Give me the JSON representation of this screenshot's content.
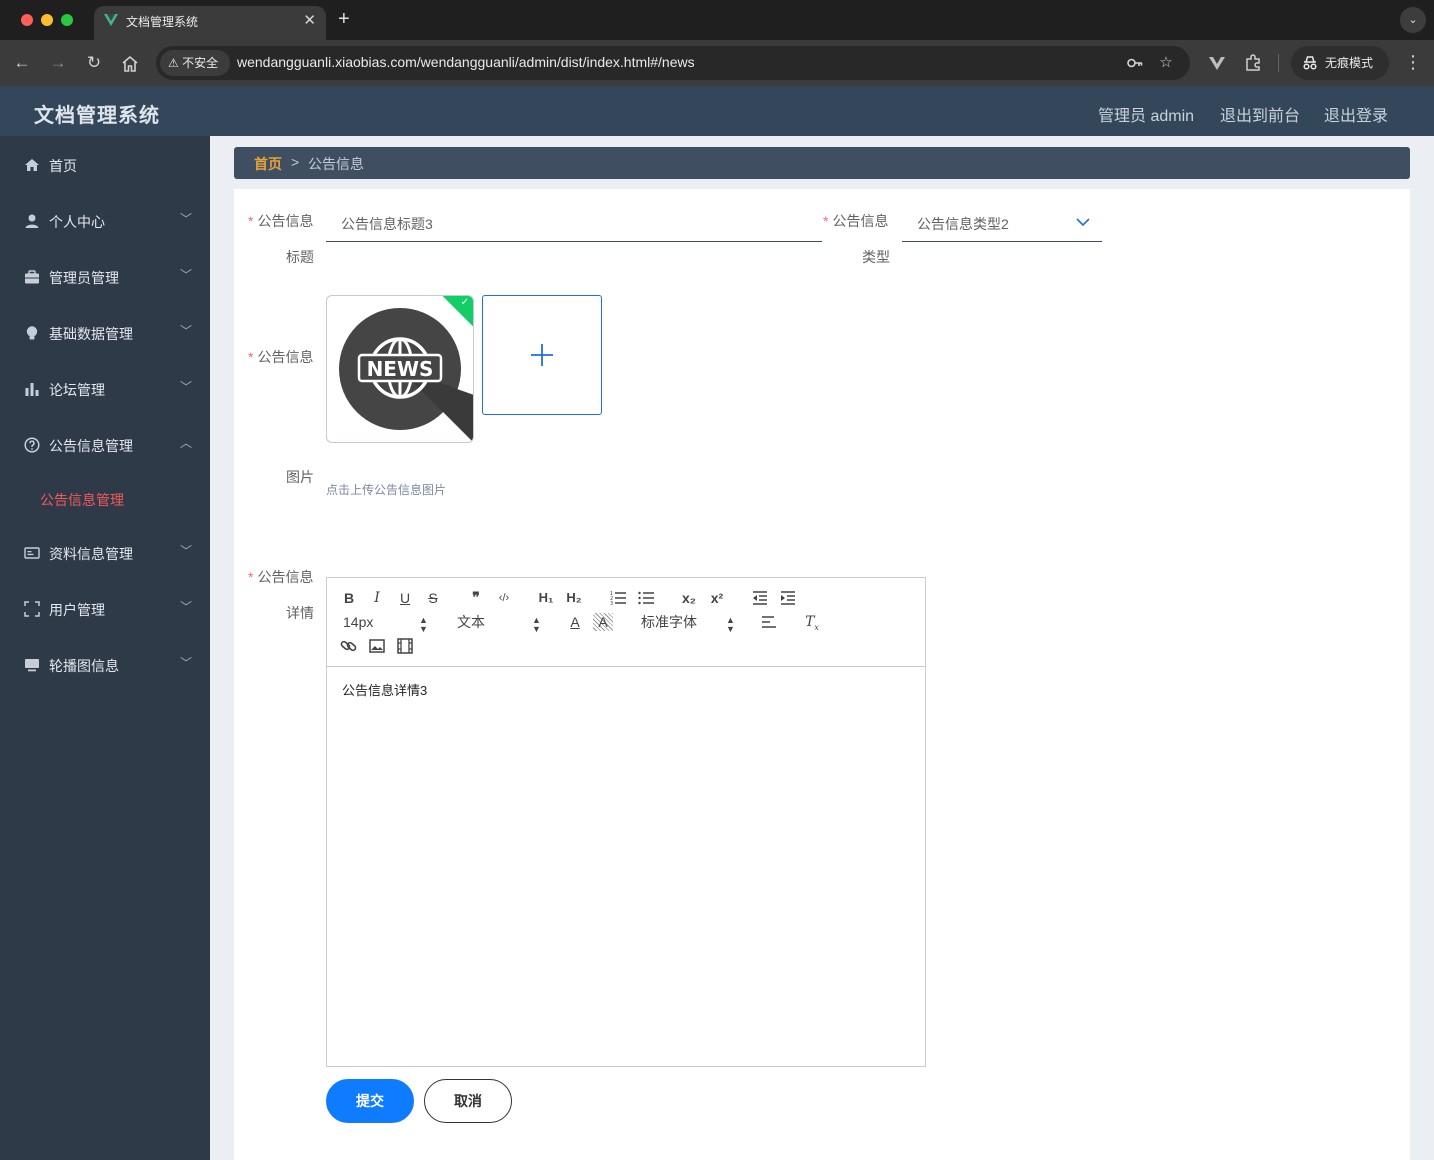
{
  "browser": {
    "tab_title": "文档管理系统",
    "tab_close": "✕",
    "new_tab": "+",
    "tab_menu": "⌄",
    "security_label": "不安全",
    "url": "wendangguanli.xiaobias.com/wendangguanli/admin/dist/index.html#/news",
    "incognito_label": "无痕模式"
  },
  "header": {
    "title": "文档管理系统",
    "user": "管理员 admin",
    "to_frontend": "退出到前台",
    "logout": "退出登录"
  },
  "sidebar": {
    "items": [
      {
        "label": "首页",
        "icon": "home-icon",
        "has_children": false
      },
      {
        "label": "个人中心",
        "icon": "user-icon",
        "has_children": true
      },
      {
        "label": "管理员管理",
        "icon": "briefcase-icon",
        "has_children": true
      },
      {
        "label": "基础数据管理",
        "icon": "bulb-icon",
        "has_children": true
      },
      {
        "label": "论坛管理",
        "icon": "bar-chart-icon",
        "has_children": true
      },
      {
        "label": "公告信息管理",
        "icon": "help-circle-icon",
        "has_children": true,
        "expanded": true
      },
      {
        "label": "资料信息管理",
        "icon": "id-card-icon",
        "has_children": true
      },
      {
        "label": "用户管理",
        "icon": "frame-icon",
        "has_children": true
      },
      {
        "label": "轮播图信息",
        "icon": "monitor-icon",
        "has_children": true
      }
    ],
    "subitem": "公告信息管理",
    "active_color": "#f05a5a"
  },
  "breadcrumb": {
    "home": "首页",
    "separator": ">",
    "current": "公告信息"
  },
  "form": {
    "required_mark": "*",
    "title_label_1": "公告信息",
    "title_label_2": "标题",
    "title_value": "公告信息标题3",
    "type_label_1": "公告信息",
    "type_label_2": "类型",
    "type_value": "公告信息类型2",
    "image_label_1": "公告信息",
    "image_label_2": "图片",
    "image_alt_text": "NEWS",
    "upload_tip": "点击上传公告信息图片",
    "detail_label_1": "公告信息",
    "detail_label_2": "详情",
    "editor": {
      "font_size": "14px",
      "header_select": "文本",
      "font_family": "标准字体",
      "content": "公告信息详情3"
    },
    "submit": "提交",
    "cancel": "取消"
  },
  "colors": {
    "header_bg": "#34475a",
    "sidebar_bg": "#2f3a49",
    "primary": "#0f7cff",
    "success": "#13ce66"
  }
}
